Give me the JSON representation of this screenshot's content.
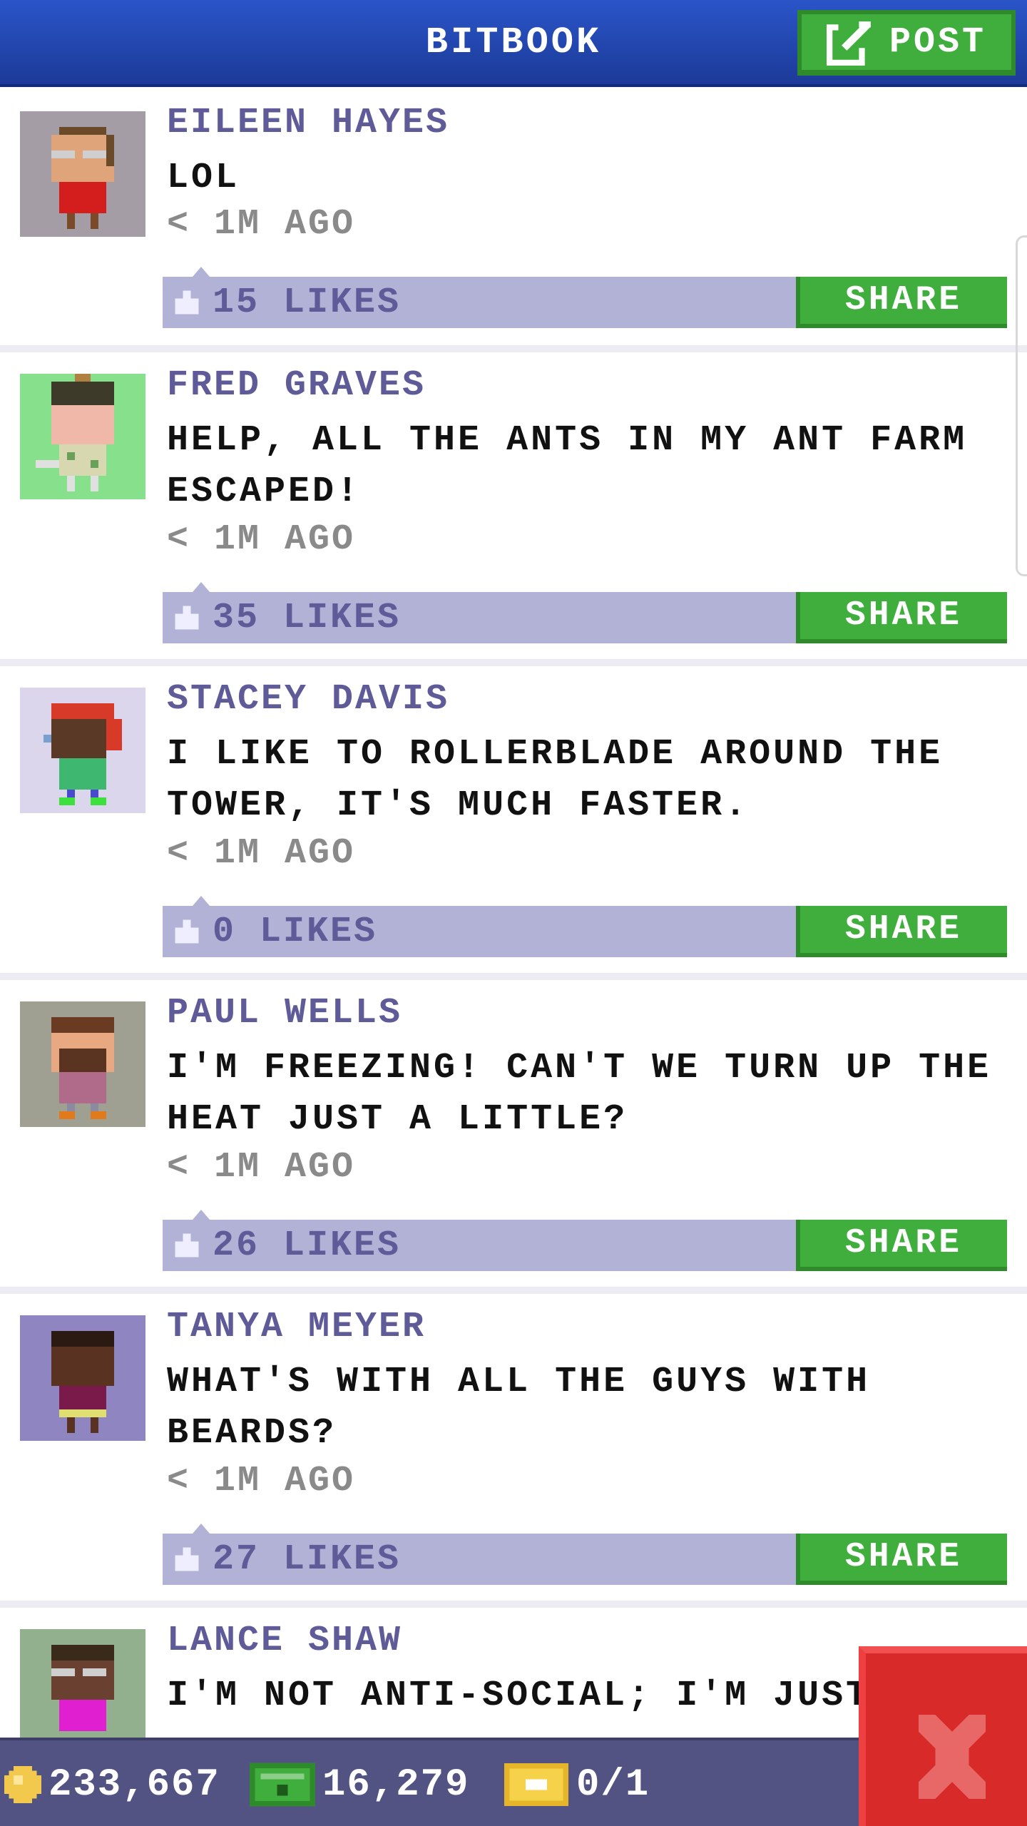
{
  "header": {
    "title": "BITBOOK",
    "post_label": "POST"
  },
  "posts": [
    {
      "author": "EILEEN HAYES",
      "message": "LOL",
      "time": "< 1M AGO",
      "likes": "15 LIKES",
      "share_label": "SHARE",
      "avatar_bg": "#a49da6",
      "lines": 1
    },
    {
      "author": "FRED GRAVES",
      "message": "HELP, ALL THE ANTS IN MY ANT FARM ESCAPED!",
      "time": "< 1M AGO",
      "likes": "35 LIKES",
      "share_label": "SHARE",
      "avatar_bg": "#86e08c",
      "lines": 2
    },
    {
      "author": "STACEY DAVIS",
      "message": "I LIKE TO ROLLERBLADE AROUND THE TOWER, IT'S MUCH FASTER.",
      "time": "< 1M AGO",
      "likes": "0 LIKES",
      "share_label": "SHARE",
      "avatar_bg": "#dcd6ec",
      "lines": 2
    },
    {
      "author": "PAUL WELLS",
      "message": "I'M FREEZING! CAN'T WE TURN UP THE HEAT JUST A LITTLE?",
      "time": "< 1M AGO",
      "likes": "26 LIKES",
      "share_label": "SHARE",
      "avatar_bg": "#9fa092",
      "lines": 2
    },
    {
      "author": "TANYA MEYER",
      "message": "WHAT'S WITH ALL THE GUYS WITH BEARDS?",
      "time": "< 1M AGO",
      "likes": "27 LIKES",
      "share_label": "SHARE",
      "avatar_bg": "#8f85c0",
      "lines": 2
    },
    {
      "author": "LANCE SHAW",
      "message": "I'M NOT ANTI-SOCIAL; I'M JUST N",
      "avatar_bg": "#92b08e"
    }
  ],
  "status": {
    "coins": "233,667",
    "bux": "16,279",
    "vip": "0/1"
  },
  "icons": {
    "post": "edit-icon",
    "like": "like-icon",
    "coin": "coin-icon",
    "bux": "bux-icon",
    "vip": "vip-ticket-icon",
    "close": "close-icon"
  },
  "colors": {
    "header": "#2a55c8",
    "green_button": "#3fae3c",
    "likes_bar": "#b1b2d6",
    "author_text": "#5f5a98",
    "status_bar": "#525383",
    "close": "#d92a2a"
  }
}
